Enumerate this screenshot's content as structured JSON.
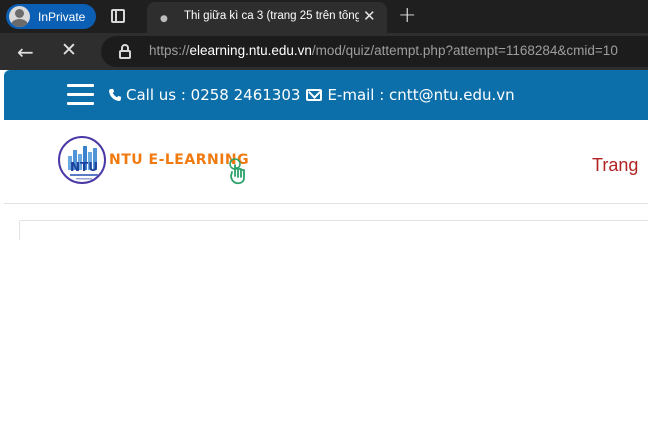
{
  "browser": {
    "inprivate_label": "InPrivate",
    "tab": {
      "title": "Thi giữa kì ca 3 (trang 25 trên tổng"
    },
    "address": {
      "protocol": "https://",
      "host": "elearning.ntu.edu.vn",
      "path": "/mod/quiz/attempt.php?attempt=1168284&cmid=10"
    }
  },
  "site": {
    "contact_phone": "Call us : 0258 2461303",
    "contact_email": "E-mail : cntt@ntu.edu.vn",
    "logo_text": "NTU E-LEARNING",
    "logo_seal_text": "NTU",
    "nav_first": "Trang"
  },
  "colors": {
    "topbar": "#0c6fa9",
    "logo_orange": "#f07a10",
    "nav_red": "#b22424",
    "inprivate_blue": "#0b5fb5"
  }
}
